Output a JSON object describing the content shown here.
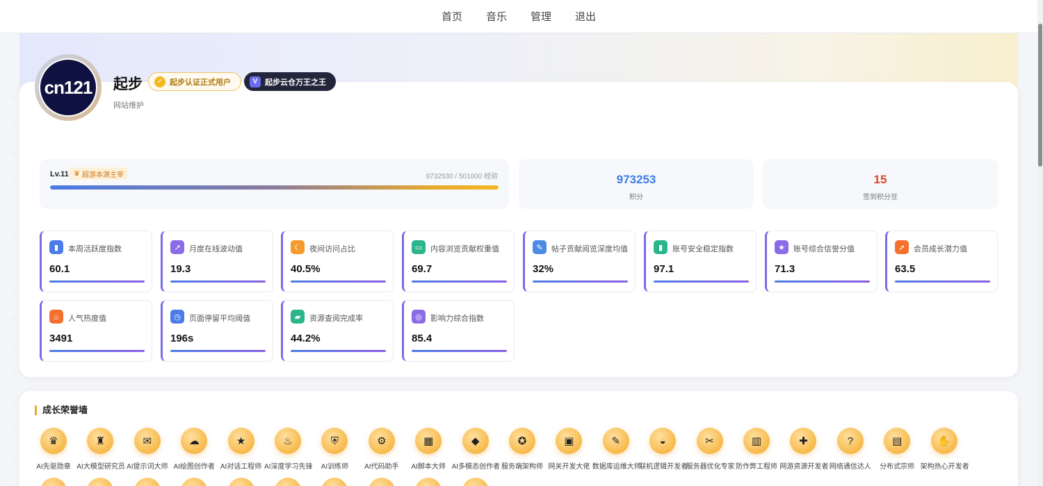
{
  "nav": [
    "首页",
    "音乐",
    "管理",
    "退出"
  ],
  "profile": {
    "avatar_text": "cn121",
    "name": "起步",
    "badge_verified": "起步认证正式用户",
    "badge_king": "起步云仓万王之王",
    "subtitle": "网站维护"
  },
  "level": {
    "label": "Lv.11",
    "tag": "超游本源主宰",
    "exp": "9732530 / 501000 经验",
    "progress": 1.0
  },
  "stats": [
    {
      "value": "973253",
      "label": "积分",
      "color": "#3b7be0"
    },
    {
      "value": "15",
      "label": "签到积分豆",
      "color": "#e0452b"
    }
  ],
  "metrics": [
    {
      "label": "本周活跃度指数",
      "value": "60.1",
      "icon": "chart-icon",
      "glyph": "▮",
      "color": "#4b7be6"
    },
    {
      "label": "月度在线波动值",
      "value": "19.3",
      "icon": "trend-icon",
      "glyph": "↗",
      "color": "#8b6be6"
    },
    {
      "label": "夜间访问占比",
      "value": "40.5%",
      "icon": "moon-icon",
      "glyph": "☾",
      "color": "#f59a2e"
    },
    {
      "label": "内容浏览贡献权重值",
      "value": "69.7",
      "icon": "book-icon",
      "glyph": "▭",
      "color": "#2bb58a"
    },
    {
      "label": "帖子贡献阅览深度均值",
      "value": "32%",
      "icon": "edit-icon",
      "glyph": "✎",
      "color": "#4b8be6"
    },
    {
      "label": "账号安全稳定指数",
      "value": "97.1",
      "icon": "shield-icon",
      "glyph": "▮",
      "color": "#2bb58a"
    },
    {
      "label": "账号综合信誉分值",
      "value": "71.3",
      "icon": "star-icon",
      "glyph": "★",
      "color": "#8b6be6"
    },
    {
      "label": "会员成长潜力值",
      "value": "63.5",
      "icon": "rocket-icon",
      "glyph": "➚",
      "color": "#f5702e"
    },
    {
      "label": "人气热度值",
      "value": "3491",
      "icon": "fire-icon",
      "glyph": "♨",
      "color": "#f5702e"
    },
    {
      "label": "页面停留平均阈值",
      "value": "196s",
      "icon": "clock-icon",
      "glyph": "◷",
      "color": "#4b7be6"
    },
    {
      "label": "资源查阅完成率",
      "value": "44.2%",
      "icon": "folder-icon",
      "glyph": "▰",
      "color": "#2bb58a"
    },
    {
      "label": "影响力综合指数",
      "value": "85.4",
      "icon": "medal-icon",
      "glyph": "◎",
      "color": "#8b6be6"
    }
  ],
  "honor_wall": {
    "title": "成长荣誉墙",
    "items": [
      {
        "label": "AI先驱勋章",
        "icon": "crown-icon",
        "glyph": "♛"
      },
      {
        "label": "AI大模型研究员",
        "icon": "trophy-icon",
        "glyph": "♜"
      },
      {
        "label": "AI提示词大师",
        "icon": "scroll-icon",
        "glyph": "✉"
      },
      {
        "label": "AI绘图创作者",
        "icon": "chat-icon",
        "glyph": "☁"
      },
      {
        "label": "AI对话工程师",
        "icon": "star-icon",
        "glyph": "★"
      },
      {
        "label": "AI深度学习先锋",
        "icon": "flame-icon",
        "glyph": "♨"
      },
      {
        "label": "AI训练师",
        "icon": "shield-icon",
        "glyph": "⛨"
      },
      {
        "label": "AI代码助手",
        "icon": "gear-icon",
        "glyph": "⚙"
      },
      {
        "label": "AI脚本大师",
        "icon": "calendar-icon",
        "glyph": "▦"
      },
      {
        "label": "AI多模态创作者",
        "icon": "diamond-icon",
        "glyph": "◆"
      },
      {
        "label": "服务端架构师",
        "icon": "medal-icon",
        "glyph": "✪"
      },
      {
        "label": "网关开发大佬",
        "icon": "image-icon",
        "glyph": "▣"
      },
      {
        "label": "数据库运维大师",
        "icon": "pencil-icon",
        "glyph": "✎"
      },
      {
        "label": "联机逻辑开发者",
        "icon": "bowl-icon",
        "glyph": "◒"
      },
      {
        "label": "服务器优化专家",
        "icon": "tools-icon",
        "glyph": "✂"
      },
      {
        "label": "防作弊工程师",
        "icon": "books-icon",
        "glyph": "▥"
      },
      {
        "label": "网游资源开发者",
        "icon": "gift-icon",
        "glyph": "✚"
      },
      {
        "label": "网络通信达人",
        "icon": "question-icon",
        "glyph": "?"
      },
      {
        "label": "分布式宗师",
        "icon": "book-icon",
        "glyph": "▤"
      },
      {
        "label": "架构热心开发者",
        "icon": "handshake-icon",
        "glyph": "✋"
      }
    ]
  }
}
